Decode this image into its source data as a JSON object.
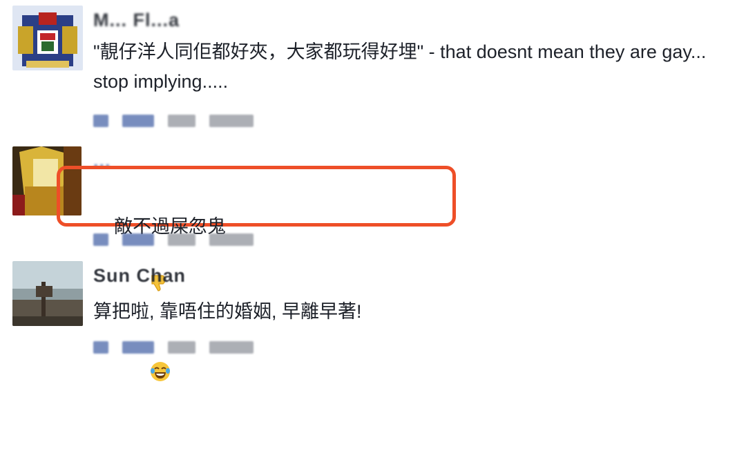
{
  "comments": [
    {
      "author": "M... Fl...a",
      "text": "\"靚仔洋人同佢都好夾，大家都玩得好埋\" - that doesnt mean they are gay... stop implying.....",
      "avatar_icon": "crest-avatar-icon"
    },
    {
      "author": "...",
      "text": "敵不過屎忽鬼",
      "emojis": [
        "thumbs-down-icon",
        "laughing-tears-icon"
      ],
      "avatar_icon": "golden-figure-avatar-icon",
      "highlighted": true,
      "highlight_color": "#ee4f28"
    },
    {
      "author": "Sun Chan",
      "text": "算把啦, 靠唔住的婚姻, 早離早著!",
      "avatar_icon": "seaside-avatar-icon"
    }
  ],
  "colors": {
    "link_blue": "#4b67a8",
    "text": "#1d2129",
    "highlight": "#ee4f28"
  }
}
